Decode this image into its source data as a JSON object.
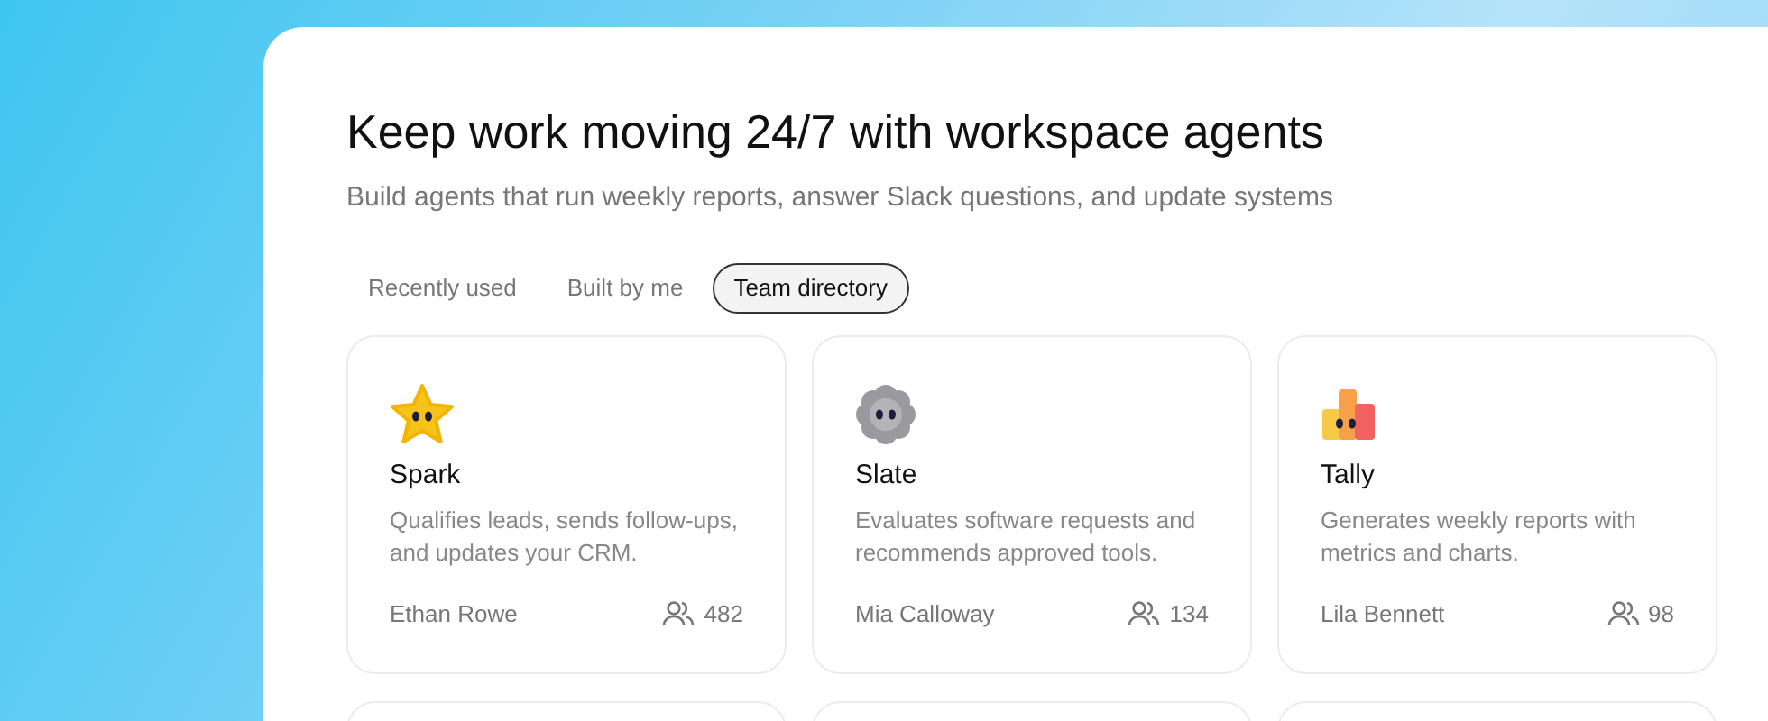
{
  "heading": "Keep work moving 24/7 with workspace agents",
  "subheading": "Build agents that run weekly reports, answer Slack questions, and update systems",
  "tabs": [
    {
      "label": "Recently used",
      "selected": false
    },
    {
      "label": "Built by me",
      "selected": false
    },
    {
      "label": "Team directory",
      "selected": true
    }
  ],
  "cards": [
    {
      "kind": "star",
      "name": "Spark",
      "description": "Qualifies leads, sends follow-ups, and updates your CRM.",
      "author": "Ethan Rowe",
      "users": "482"
    },
    {
      "kind": "flower",
      "name": "Slate",
      "description": "Evaluates software requests and recommends approved tools.",
      "author": "Mia Calloway",
      "users": "134"
    },
    {
      "kind": "bars",
      "name": "Tally",
      "description": "Generates weekly reports with metrics and charts.",
      "author": "Lila Bennett",
      "users": "98"
    },
    {
      "kind": "clipped"
    },
    {
      "kind": "clipped"
    },
    {
      "kind": "clipped"
    }
  ]
}
